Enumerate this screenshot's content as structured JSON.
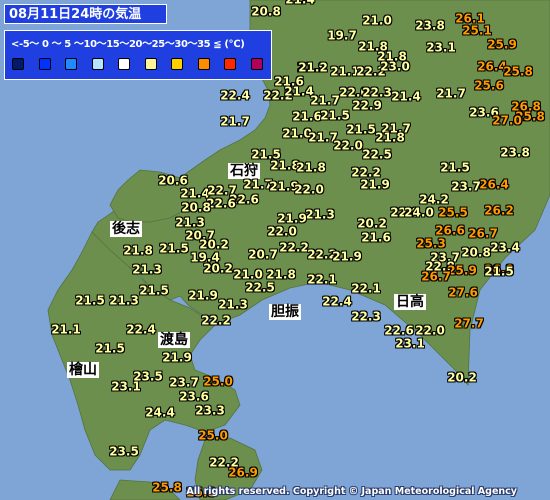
{
  "title": "08月11日24時の気温",
  "legend": {
    "scale_text": "<-5～ 0 ～ 5 ～10～15～20～25～30～35 ≦ (℃)",
    "colors": [
      "#001a6e",
      "#0033ff",
      "#1e8cff",
      "#b4e6ff",
      "#ffffff",
      "#fff59a",
      "#ffd000",
      "#ff8c00",
      "#ff2800",
      "#b4005a"
    ]
  },
  "colors": {
    "sea": "#7ea5d6",
    "land": "#6c8f4e",
    "temp_20_25": "#ffffa0",
    "temp_25_30": "#ff9a00",
    "label_bg": "#1f3fe0"
  },
  "places": [
    {
      "name": "石狩"
    },
    {
      "name": "後志"
    },
    {
      "name": "胆振"
    },
    {
      "name": "日高"
    },
    {
      "name": "渡島"
    },
    {
      "name": "檜山"
    }
  ],
  "temperatures": [
    "20.8",
    "21.4",
    "19.7",
    "21.0",
    "21.8",
    "23.8",
    "26.1",
    "25.1",
    "23.1",
    "21.8",
    "21.9",
    "25.9",
    "21.2",
    "26.4",
    "25.8",
    "21.6",
    "21.1",
    "22.2",
    "23.0",
    "21.7",
    "25.6",
    "22.2",
    "21.4",
    "22.0",
    "22.3",
    "21.4",
    "26.8",
    "25.8",
    "22.9",
    "21.7",
    "21.6",
    "23.6",
    "27.0",
    "22.4",
    "21.7",
    "21.5",
    "21.7",
    "21.0",
    "21.7",
    "21.5",
    "21.8",
    "22.0",
    "23.8",
    "21.5",
    "22.5",
    "21.8",
    "21.8",
    "21.5",
    "26.4",
    "23.7",
    "20.6",
    "22.2",
    "21.7",
    "21.9",
    "22.0",
    "21.4",
    "22.7",
    "22.6",
    "21.9",
    "22.6",
    "24.2",
    "22.8",
    "21.3",
    "21.9",
    "25.5",
    "26.2",
    "24.0",
    "20.8",
    "20.7",
    "21.3",
    "22.0",
    "21.6",
    "26.7",
    "26.6",
    "20.2",
    "22.2",
    "22.2",
    "20.8",
    "25.3",
    "23.4",
    "21.8",
    "21.5",
    "20.2",
    "20.7",
    "21.9",
    "23.7",
    "19.4",
    "22.8",
    "25.9",
    "26.8",
    "21.3",
    "20.2",
    "21.8",
    "22.1",
    "26.7",
    "21.5",
    "21.0",
    "22.5",
    "22.1",
    "21.5",
    "22.4",
    "21.5",
    "21.9",
    "21.3",
    "27.6",
    "21.3",
    "22.2",
    "22.3",
    "22.6",
    "22.0",
    "27.7",
    "21.1",
    "22.4",
    "23.1",
    "21.5",
    "21.9",
    "20.2",
    "23.5",
    "23.1",
    "23.7",
    "25.0",
    "23.6",
    "24.4",
    "23.3",
    "25.0",
    "23.5",
    "26.9",
    "25.8",
    "25.8",
    "22.2"
  ],
  "copyright": "All rights reserved. Copyright © Japan Meteorological Agency"
}
